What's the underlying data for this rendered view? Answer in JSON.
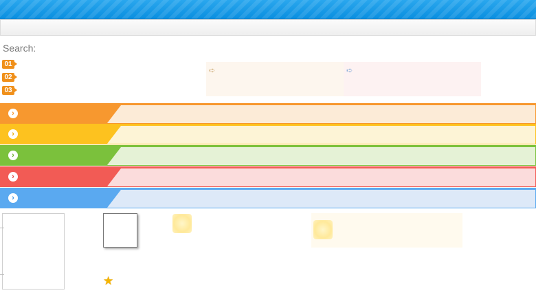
{
  "search": {
    "label": "Search:"
  },
  "steps": [
    "01",
    "02",
    "03"
  ],
  "notes": [
    {
      "icon": "arrow-right-icon",
      "color": "#fdf6ee"
    },
    {
      "icon": "arrow-right-icon",
      "color": "#fdf2f2"
    }
  ],
  "bars": [
    {
      "name": "orange",
      "accent": "#f7982f",
      "fill": "#fcebd7",
      "icon": "chevron-right-icon"
    },
    {
      "name": "yellow",
      "accent": "#fdc21f",
      "fill": "#fdf4d6",
      "icon": "chevron-right-icon"
    },
    {
      "name": "green",
      "accent": "#7bc13c",
      "fill": "#e5f2d6",
      "icon": "chevron-right-icon"
    },
    {
      "name": "red",
      "accent": "#f25b55",
      "fill": "#fbdcdc",
      "icon": "chevron-right-icon"
    },
    {
      "name": "blue",
      "accent": "#5aa9f0",
      "fill": "#dde9f8",
      "icon": "chevron-right-icon"
    }
  ],
  "decor": {
    "star_icon": "star-icon",
    "star_color": "#f5b500"
  }
}
